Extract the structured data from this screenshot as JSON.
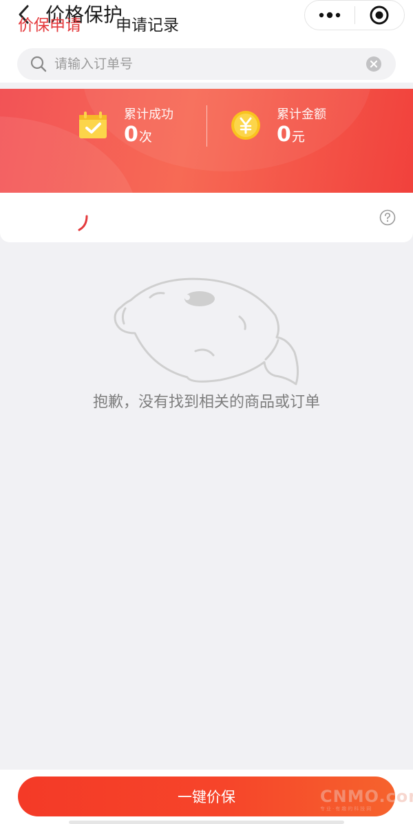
{
  "header": {
    "title": "价格保护",
    "icons": {
      "back": "chevron-left-icon",
      "more": "more-dots-icon",
      "record": "target-icon"
    }
  },
  "search": {
    "placeholder": "请输入订单号",
    "value": "",
    "icons": {
      "search": "search-icon",
      "clear": "clear-icon"
    }
  },
  "stats": [
    {
      "label": "累计成功",
      "value": "0",
      "unit": "次",
      "icon": "calendar-check-icon"
    },
    {
      "label": "累计金额",
      "value": "0",
      "unit": "元",
      "icon": "yen-coin-icon"
    }
  ],
  "tabs": [
    {
      "label": "价保申请",
      "active": true
    },
    {
      "label": "申请记录",
      "active": false
    }
  ],
  "help_icon": "help-circle-icon",
  "empty": {
    "message": "抱歉，没有找到相关的商品或订单",
    "illustration": "fish-mascot-illustration"
  },
  "action": {
    "label": "一键价保"
  },
  "watermark": {
    "main": "CNMO.com",
    "sub": "专业·有趣的科技网"
  },
  "colors": {
    "accent": "#e4393c",
    "banner_start": "#f25356",
    "banner_end": "#f1413c",
    "button": "#f43a27"
  }
}
